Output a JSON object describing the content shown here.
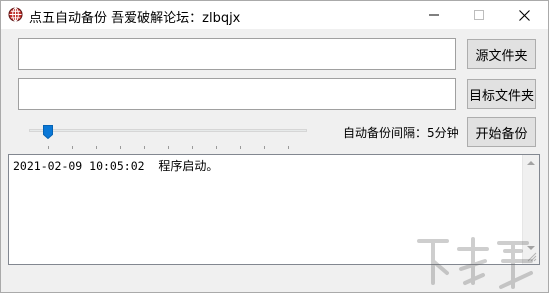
{
  "window": {
    "title": "点五自动备份      吾爱破解论坛：zlbqjx",
    "controls": [
      "minimize",
      "maximize",
      "close"
    ]
  },
  "source": {
    "value": "",
    "button_label": "源文件夹"
  },
  "target": {
    "value": "",
    "button_label": "目标文件夹"
  },
  "interval": {
    "label": "自动备份间隔：5分钟",
    "slider_value_minutes": 5
  },
  "start_button_label": "开始备份",
  "log": {
    "entries": [
      {
        "timestamp": "2021-02-09 10:05:02",
        "message": "程序启动。"
      }
    ]
  },
  "icons": {
    "app": "globe-icon",
    "minimize": "minimize-icon",
    "maximize": "maximize-icon",
    "close": "close-icon"
  }
}
